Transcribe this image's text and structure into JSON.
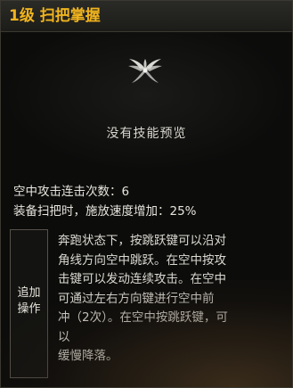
{
  "tooltip": {
    "title": "1级 扫把掌握",
    "icon": "winged-skill-icon",
    "no_preview": "没有技能预览",
    "stats": [
      "空中攻击连击次数：6",
      "装备扫把时，施放速度增加：25%"
    ],
    "addon": {
      "label_line1": "追加",
      "label_line2": "操作",
      "description_lines": [
        "奔跑状态下，按跳跃键可以沿对",
        "角线方向空中跳跃。在空中按攻",
        "击键可以发动连续攻击。在空中",
        "可通过左右方向键进行空中前",
        "冲（2次）。在空中按跳跃键，可",
        "以",
        "缓慢降落。"
      ]
    },
    "colors": {
      "title": "#f0b41e",
      "text": "#e6e4dc",
      "border": "#55524a"
    }
  }
}
